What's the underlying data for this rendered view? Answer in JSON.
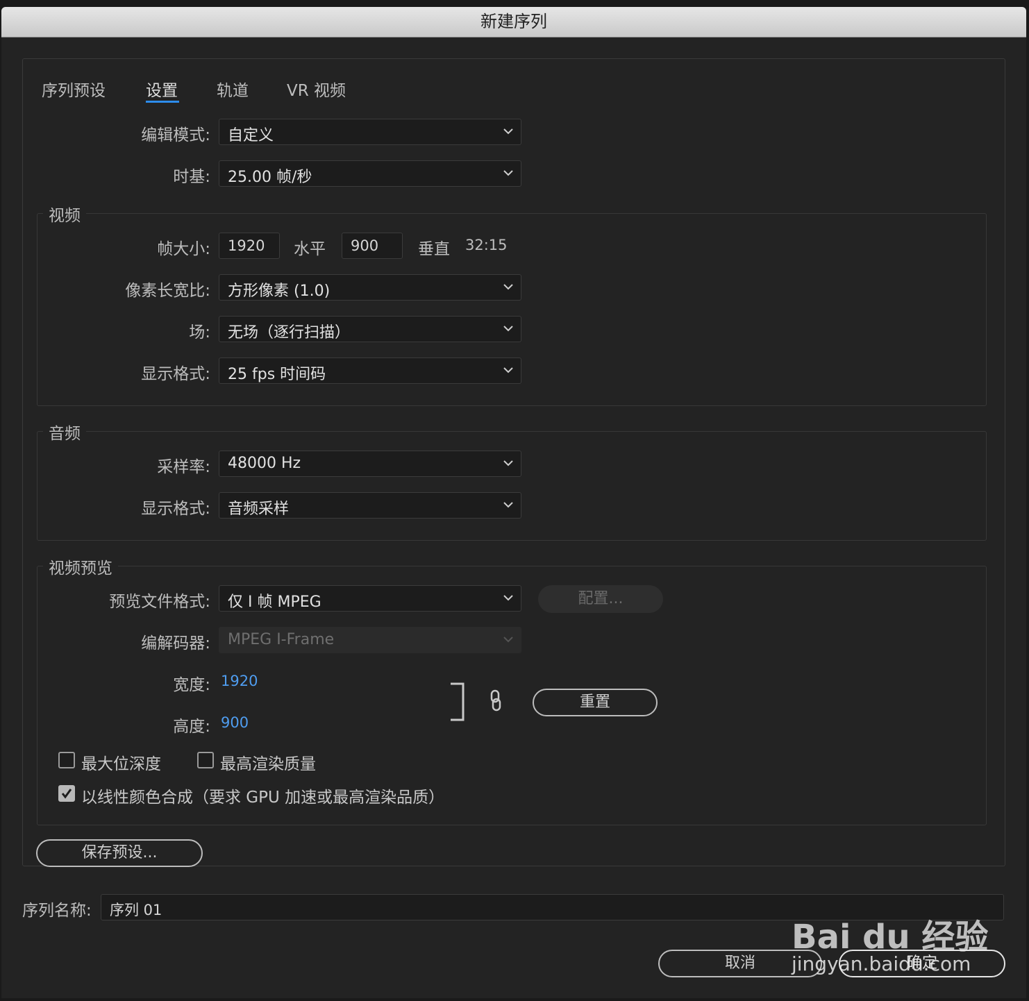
{
  "window": {
    "title": "新建序列"
  },
  "tabs": [
    "序列预设",
    "设置",
    "轨道",
    "VR 视频"
  ],
  "settings": {
    "edit_mode": {
      "label": "编辑模式:",
      "value": "自定义"
    },
    "timebase": {
      "label": "时基:",
      "value": "25.00  帧/秒"
    }
  },
  "video": {
    "title": "视频",
    "frame_size": {
      "label": "帧大小:",
      "width": "1920",
      "horizontal_label": "水平",
      "height": "900",
      "vertical_label": "垂直",
      "ratio": "32:15"
    },
    "pixel_aspect": {
      "label": "像素长宽比:",
      "value": "方形像素 (1.0)"
    },
    "fields": {
      "label": "场:",
      "value": "无场（逐行扫描）"
    },
    "display_format": {
      "label": "显示格式:",
      "value": "25 fps 时间码"
    }
  },
  "audio": {
    "title": "音频",
    "sample_rate": {
      "label": "采样率:",
      "value": "48000 Hz"
    },
    "display_format": {
      "label": "显示格式:",
      "value": "音频采样"
    }
  },
  "video_preview": {
    "title": "视频预览",
    "file_format": {
      "label": "预览文件格式:",
      "value": "仅 I 帧 MPEG"
    },
    "configure_label": "配置...",
    "codec": {
      "label": "编解码器:",
      "value": "MPEG I-Frame"
    },
    "width": {
      "label": "宽度:",
      "value": "1920"
    },
    "height": {
      "label": "高度:",
      "value": "900"
    },
    "reset_label": "重置",
    "max_bit_depth": {
      "label": "最大位深度",
      "checked": false
    },
    "max_render_quality": {
      "label": "最高渲染质量",
      "checked": false
    },
    "linear_color": {
      "label": "以线性颜色合成（要求 GPU 加速或最高渲染品质）",
      "checked": true
    }
  },
  "save_preset_label": "保存预设...",
  "sequence_name": {
    "label": "序列名称:",
    "value": "序列 01"
  },
  "buttons": {
    "cancel": "取消",
    "ok": "确定"
  },
  "watermark": {
    "brand": "Bai du 经验",
    "url": "jingyan.baidu.com"
  },
  "colors": {
    "accent": "#2d8ceb",
    "link_value": "#4f9df0",
    "background": "#232323"
  }
}
